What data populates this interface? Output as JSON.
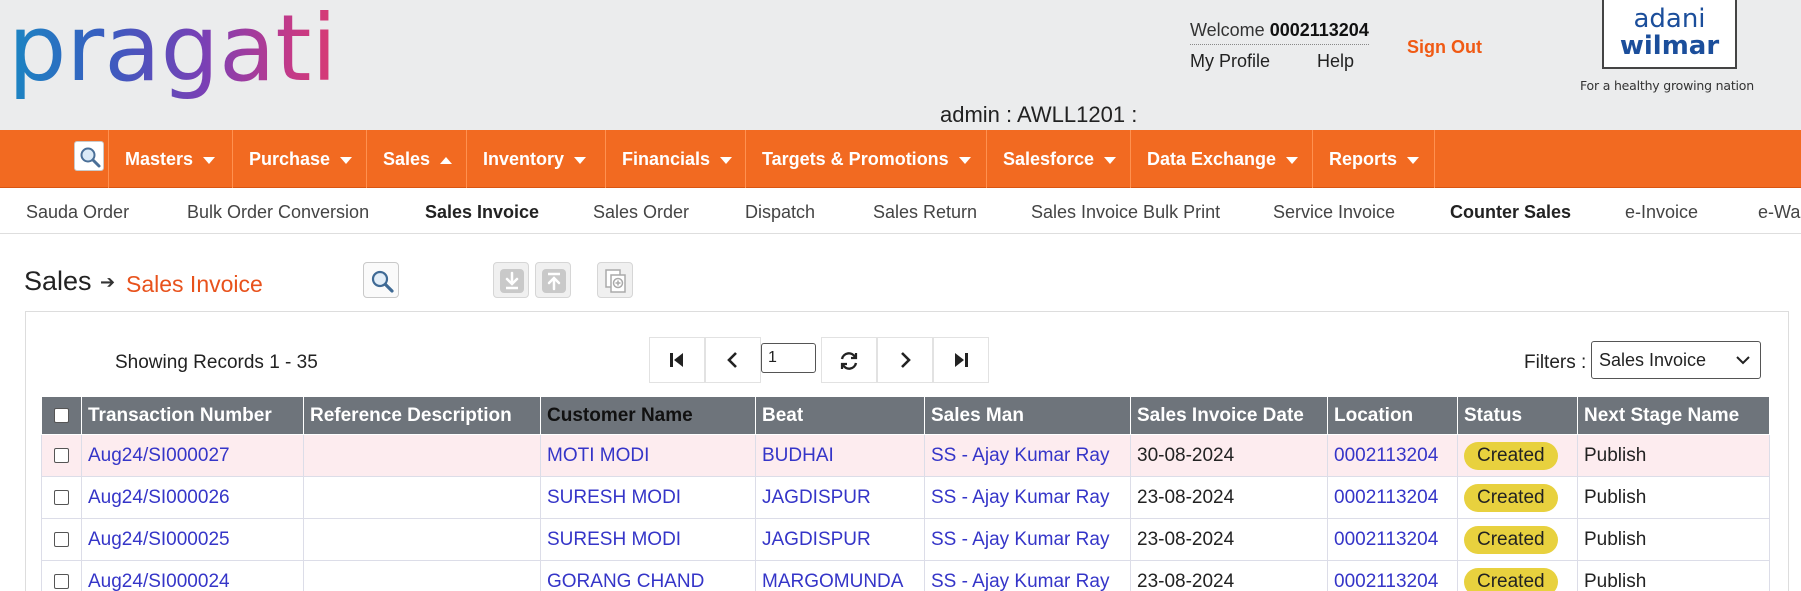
{
  "header": {
    "logo_text": "pragati",
    "welcome_prefix": "Welcome",
    "user_id": "0002113204",
    "my_profile": "My Profile",
    "help": "Help",
    "sign_out": "Sign Out",
    "brand_line1": "adani",
    "brand_line2": "wilmar",
    "brand_tagline": "For a healthy growing nation",
    "admin_label": "admin : AWLL1201 :"
  },
  "nav": {
    "search_icon": "search-icon",
    "items": [
      {
        "label": "Masters",
        "caret": "down"
      },
      {
        "label": "Purchase",
        "caret": "down"
      },
      {
        "label": "Sales",
        "caret": "up"
      },
      {
        "label": "Inventory",
        "caret": "down"
      },
      {
        "label": "Financials",
        "caret": "down"
      },
      {
        "label": "Targets & Promotions",
        "caret": "down"
      },
      {
        "label": "Salesforce",
        "caret": "down"
      },
      {
        "label": "Data Exchange",
        "caret": "down"
      },
      {
        "label": "Reports",
        "caret": "down"
      }
    ]
  },
  "subnav": {
    "items": [
      {
        "label": "Sauda Order"
      },
      {
        "label": "Bulk Order Conversion"
      },
      {
        "label": "Sales Invoice",
        "active": true
      },
      {
        "label": "Sales Order"
      },
      {
        "label": "Dispatch"
      },
      {
        "label": "Sales Return"
      },
      {
        "label": "Sales Invoice Bulk Print"
      },
      {
        "label": "Service Invoice"
      },
      {
        "label": "Counter Sales",
        "active": true
      },
      {
        "label": "e-Invoice"
      },
      {
        "label": "e-Wa"
      }
    ]
  },
  "page": {
    "breadcrumb_parent": "Sales",
    "breadcrumb_current": "Sales Invoice",
    "showing_records": "Showing Records 1 - 35",
    "page_number": "1",
    "filters_label": "Filters :",
    "filter_value": "Sales Invoice"
  },
  "colors": {
    "accent": "#f26a21",
    "link": "#3535c8",
    "badge": "#e8d13e",
    "header_bg": "#6e747b"
  },
  "table": {
    "columns": [
      "Transaction Number",
      "Reference Description",
      "Customer Name",
      "Beat",
      "Sales Man",
      "Sales Invoice Date",
      "Location",
      "Status",
      "Next Stage Name"
    ],
    "rows": [
      {
        "transaction": "Aug24/SI000027",
        "reference": "",
        "customer": "MOTI MODI",
        "beat": "BUDHAI",
        "salesman": "SS - Ajay Kumar Ray",
        "date": "30-08-2024",
        "location": "0002113204",
        "status": "Created",
        "next_stage": "Publish"
      },
      {
        "transaction": "Aug24/SI000026",
        "reference": "",
        "customer": "SURESH MODI",
        "beat": "JAGDISPUR",
        "salesman": "SS - Ajay Kumar Ray",
        "date": "23-08-2024",
        "location": "0002113204",
        "status": "Created",
        "next_stage": "Publish"
      },
      {
        "transaction": "Aug24/SI000025",
        "reference": "",
        "customer": "SURESH MODI",
        "beat": "JAGDISPUR",
        "salesman": "SS - Ajay Kumar Ray",
        "date": "23-08-2024",
        "location": "0002113204",
        "status": "Created",
        "next_stage": "Publish"
      },
      {
        "transaction": "Aug24/SI000024",
        "reference": "",
        "customer": "GORANG CHAND",
        "beat": "MARGOMUNDA",
        "salesman": "SS - Ajay Kumar Ray",
        "date": "23-08-2024",
        "location": "0002113204",
        "status": "Created",
        "next_stage": "Publish"
      }
    ]
  }
}
